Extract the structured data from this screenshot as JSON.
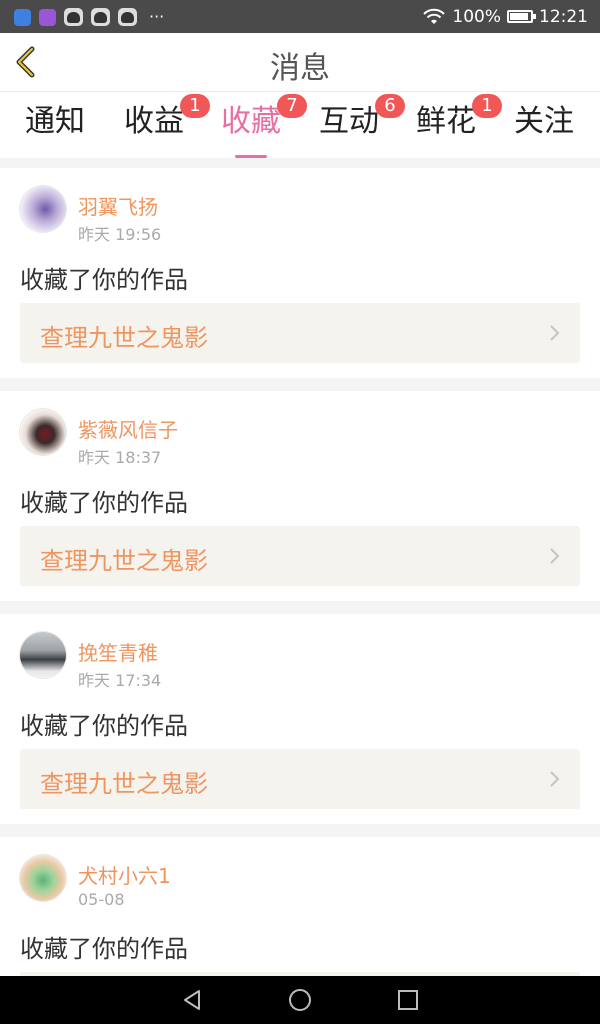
{
  "status_bar": {
    "battery": "100%",
    "time": "12:21",
    "battery_level": 1.0,
    "icons": [
      "k-app-icon",
      "gallery-app-icon",
      "dog-app-icon",
      "dog-app-icon",
      "dog-app-icon",
      "more-dots-icon",
      "wifi-icon",
      "battery-icon"
    ]
  },
  "header": {
    "title": "消息",
    "back_icon": "chevron-left-icon"
  },
  "tabs": [
    {
      "label": "通知",
      "badge": null,
      "active": false
    },
    {
      "label": "收益",
      "badge": "1",
      "active": false
    },
    {
      "label": "收藏",
      "badge": "7",
      "active": true
    },
    {
      "label": "互动",
      "badge": "6",
      "active": false
    },
    {
      "label": "鲜花",
      "badge": "1",
      "active": false
    },
    {
      "label": "关注",
      "badge": null,
      "active": false
    }
  ],
  "feed": [
    {
      "username": "羽翼飞扬",
      "time": "昨天 19:56",
      "message": "收藏了你的作品",
      "work_title": "查理九世之鬼影"
    },
    {
      "username": "紫薇风信子",
      "time": "昨天 18:37",
      "message": "收藏了你的作品",
      "work_title": "查理九世之鬼影"
    },
    {
      "username": "挽笙青稚",
      "time": "昨天 17:34",
      "message": "收藏了你的作品",
      "work_title": "查理九世之鬼影"
    },
    {
      "username": "犬村小六1",
      "time": "05-08",
      "message": "收藏了你的作品",
      "work_title": ""
    }
  ],
  "colors": {
    "accent": "#e96ea2",
    "username": "#f0955f",
    "badge": "#f25757",
    "link_bg": "#f4f3ee"
  }
}
